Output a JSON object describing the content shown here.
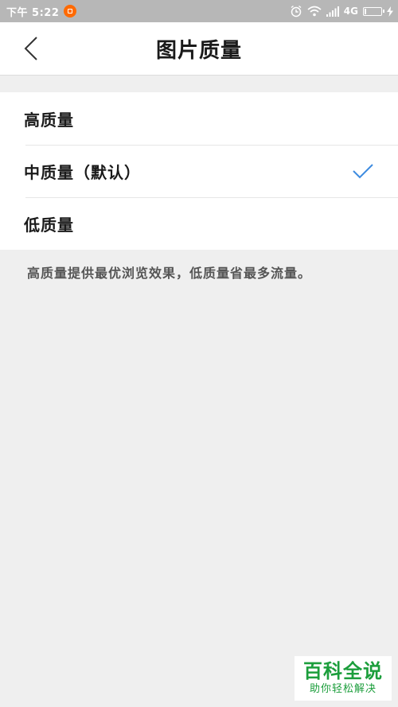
{
  "status_bar": {
    "time": "下午 5:22",
    "network": "4G",
    "battery_level": 0.1,
    "icons": [
      "app-notification-icon",
      "alarm-icon",
      "wifi-icon",
      "signal-icon",
      "battery-icon",
      "charging-icon"
    ]
  },
  "nav": {
    "title": "图片质量",
    "back_icon": "chevron-left-icon"
  },
  "options": [
    {
      "label": "高质量",
      "selected": false
    },
    {
      "label": "中质量（默认）",
      "selected": true
    },
    {
      "label": "低质量",
      "selected": false
    }
  ],
  "hint": "高质量提供最优浏览效果，低质量省最多流量。",
  "watermark": {
    "main": "百科全说",
    "sub": "助你轻松解决"
  },
  "colors": {
    "accent_check": "#3d8be0",
    "watermark_green": "#1c9e3c",
    "status_bar": "#b7b7b7"
  }
}
